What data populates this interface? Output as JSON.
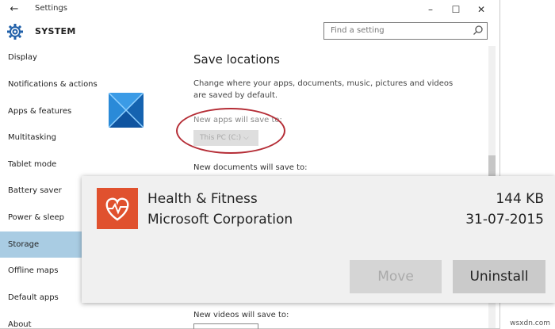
{
  "window": {
    "title": "Settings",
    "controls": [
      "–",
      "☐",
      "✕"
    ]
  },
  "header": {
    "section": "SYSTEM",
    "search_placeholder": "Find a setting"
  },
  "sidebar": {
    "items": [
      {
        "label": "Display"
      },
      {
        "label": "Notifications & actions"
      },
      {
        "label": "Apps & features"
      },
      {
        "label": "Multitasking"
      },
      {
        "label": "Tablet mode"
      },
      {
        "label": "Battery saver"
      },
      {
        "label": "Power & sleep"
      },
      {
        "label": "Storage",
        "active": true
      },
      {
        "label": "Offline maps"
      },
      {
        "label": "Default apps"
      },
      {
        "label": "About"
      }
    ]
  },
  "content": {
    "title": "Save locations",
    "description": "Change where your apps, documents, music, pictures and videos are saved by default.",
    "apps_label": "New apps will save to:",
    "apps_value": "This PC (C:)",
    "docs_label": "New documents will save to:",
    "videos_label": "New videos will save to:"
  },
  "app_panel": {
    "name": "Health & Fitness",
    "publisher": "Microsoft Corporation",
    "size": "144 KB",
    "date": "31-07-2015",
    "move_label": "Move",
    "uninstall_label": "Uninstall"
  },
  "watermark": "wsxdn.com",
  "colors": {
    "selected_nav": "#a9cce3",
    "app_tile": "#e0512e",
    "highlight_circle": "#b52d36",
    "logo": "#1f73c6"
  }
}
